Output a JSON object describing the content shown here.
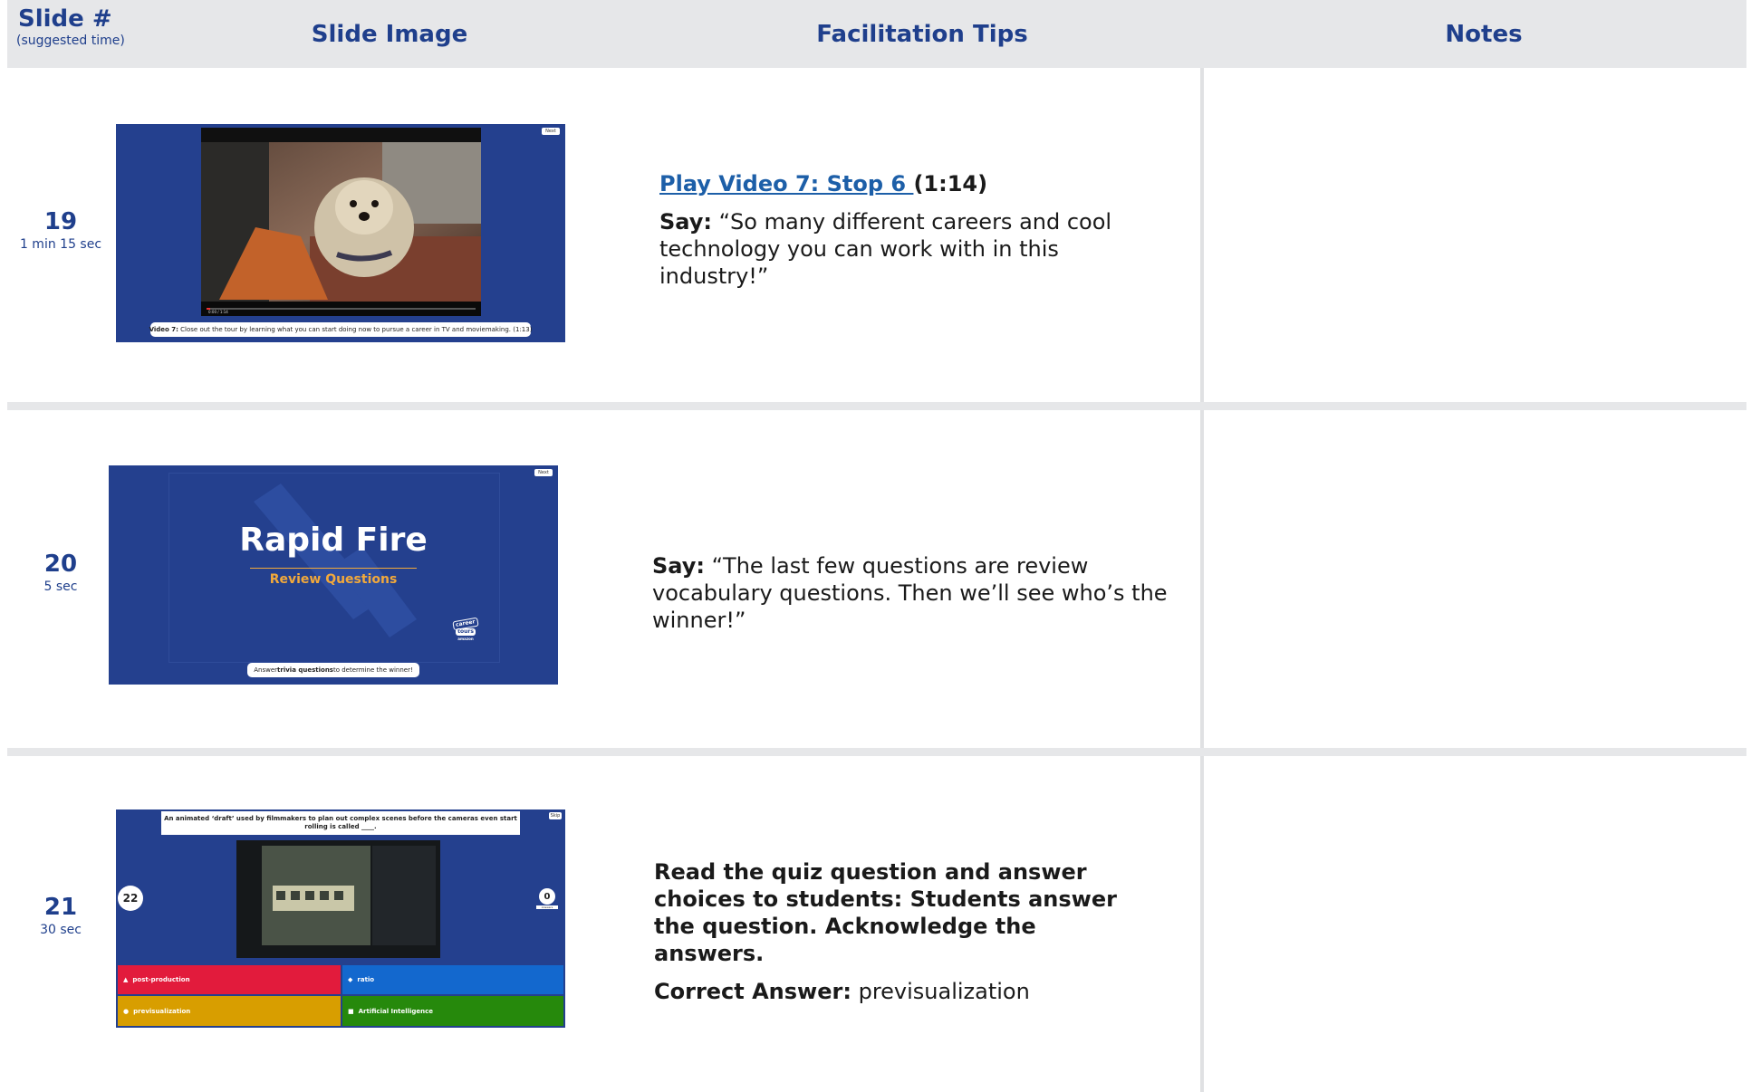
{
  "header": {
    "slide_label": "Slide #",
    "slide_sub": "(suggested time)",
    "image_label": "Slide Image",
    "tips_label": "Facilitation Tips",
    "notes_label": "Notes"
  },
  "rows": [
    {
      "number": "19",
      "duration": "1 min 15 sec",
      "link_text": "Play Video 7: Stop 6 ",
      "link_suffix": "(1:14)",
      "say_label": "Say:",
      "say_text": "“So many different careers and cool technology you can work with in this industry!”",
      "slide": {
        "next_label": "Next",
        "caption_bold": "Video 7:",
        "caption_text": "Close out the tour by learning what you can start doing now to pursue a career in TV and moviemaking. (1:13)",
        "player_time": "0:00 / 1:14"
      }
    },
    {
      "number": "20",
      "duration": "5 sec",
      "say_label": "Say:",
      "say_text": "“The last few questions are review vocabulary questions. Then we’ll see who’s the winner!”",
      "slide": {
        "next_label": "Next",
        "title": "Rapid Fire",
        "subtitle": "Review Questions",
        "logo_line1": "career",
        "logo_line2": "tours",
        "logo_line3": "amazon",
        "caption_pre": "Answer ",
        "caption_bold": "trivia questions",
        "caption_post": " to determine the winner!"
      }
    },
    {
      "number": "21",
      "duration": "30 sec",
      "instruction": "Read the quiz question and answer choices to students: Students answer the question. Acknowledge the answers.",
      "answer_label": "Correct Answer:",
      "answer_text": "previsualization",
      "slide": {
        "skip_label": "Skip",
        "question": "An animated ‘draft’ used by filmmakers to plan out complex scenes before the cameras even start rolling is called ____.",
        "timer": "22",
        "answers_count": "0",
        "answers_label": "Answers",
        "options": [
          {
            "shape": "▲",
            "label": "post-production",
            "color": "#e21b3c"
          },
          {
            "shape": "◆",
            "label": "ratio",
            "color": "#1368ce"
          },
          {
            "shape": "●",
            "label": "previsualization",
            "color": "#d89e00"
          },
          {
            "shape": "■",
            "label": "Artificial Intelligence",
            "color": "#26890c"
          }
        ]
      }
    }
  ]
}
